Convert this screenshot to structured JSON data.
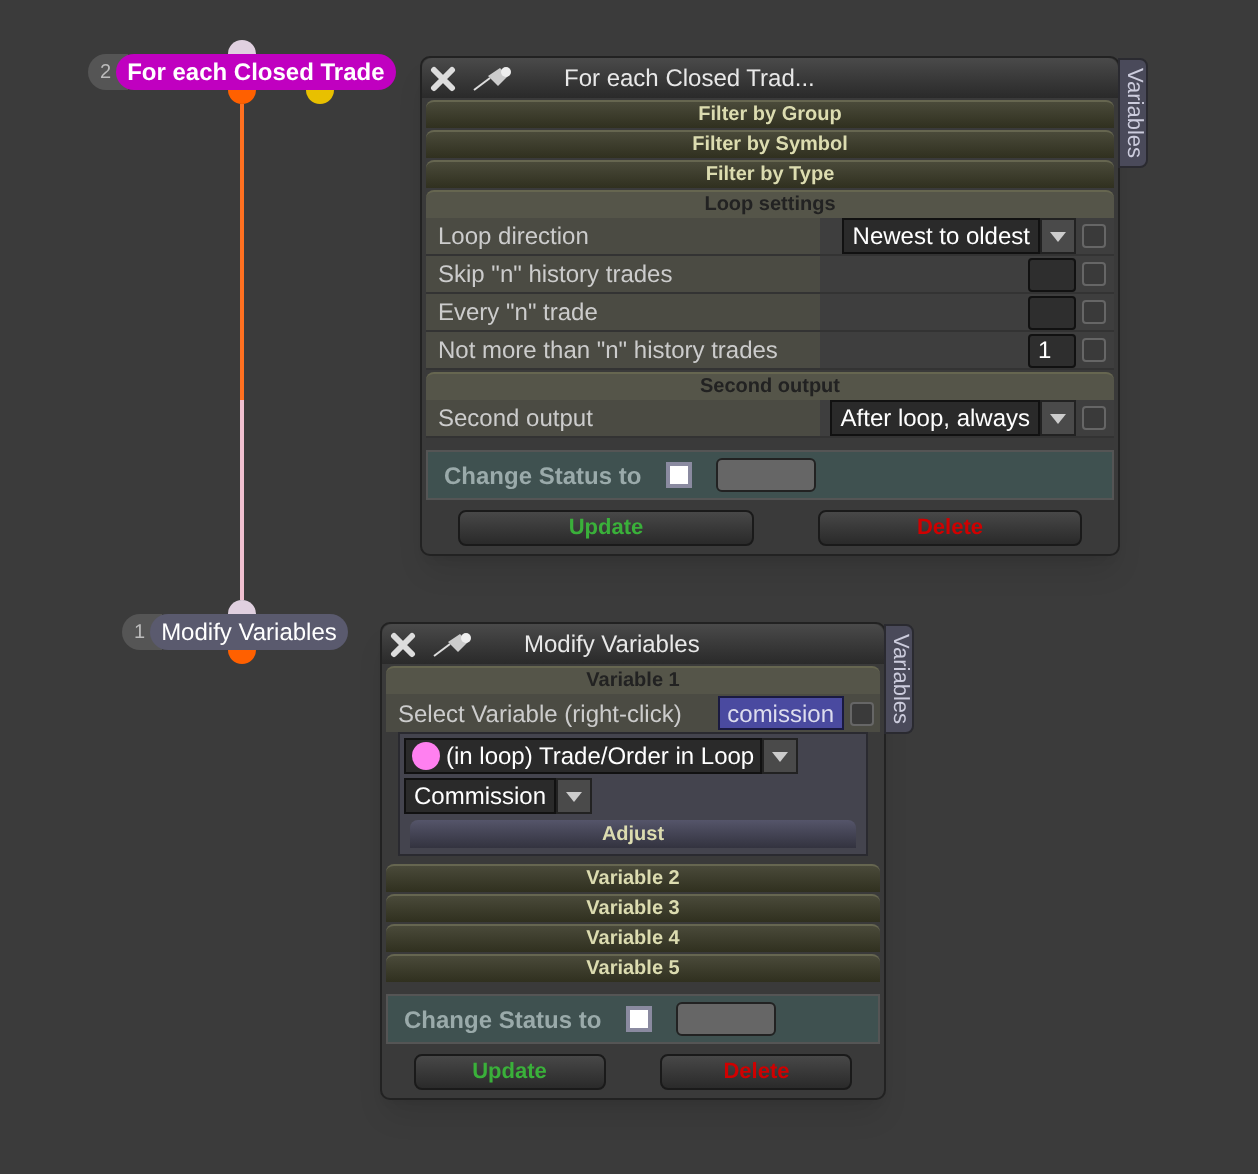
{
  "nodes": [
    {
      "number": "2",
      "label": "For each Closed Trade",
      "color": "#c000c0"
    },
    {
      "number": "1",
      "label": "Modify Variables",
      "color": "#5a5a6e"
    }
  ],
  "loop_window": {
    "title": "For each Closed Trad...",
    "side_tab": "Variables",
    "filters": [
      "Filter by Group",
      "Filter by Symbol",
      "Filter by Type"
    ],
    "sections": [
      {
        "header": "Loop settings",
        "rows": [
          {
            "kind": "dropdown",
            "label": "Loop direction",
            "value": "Newest to oldest",
            "checked": false
          },
          {
            "kind": "number",
            "label": "Skip \"n\" history trades",
            "value": "",
            "checked": false
          },
          {
            "kind": "number",
            "label": "Every \"n\" trade",
            "value": "",
            "checked": false
          },
          {
            "kind": "number",
            "label": "Not more than \"n\" history trades",
            "value": "1",
            "checked": false
          }
        ]
      },
      {
        "header": "Second output",
        "rows": [
          {
            "kind": "dropdown",
            "label": "Second output",
            "value": "After loop, always",
            "checked": false
          }
        ]
      }
    ],
    "change_status": {
      "label": "Change Status to",
      "checked": false
    },
    "buttons": {
      "update": "Update",
      "delete": "Delete"
    }
  },
  "modify_window": {
    "title": "Modify Variables",
    "side_tab": "Variables",
    "variables": [
      {
        "header": "Variable 1",
        "expanded": true,
        "select_label": "Select Variable (right-click)",
        "variable": "comission",
        "checked": false,
        "source": "(in loop) Trade/Order in Loop",
        "color": "#ff80f0",
        "property": "Commission",
        "adjust": "Adjust"
      },
      {
        "header": "Variable 2",
        "expanded": false
      },
      {
        "header": "Variable 3",
        "expanded": false
      },
      {
        "header": "Variable 4",
        "expanded": false
      },
      {
        "header": "Variable 5",
        "expanded": false
      }
    ],
    "change_status": {
      "label": "Change Status to",
      "checked": false
    },
    "buttons": {
      "update": "Update",
      "delete": "Delete"
    }
  }
}
